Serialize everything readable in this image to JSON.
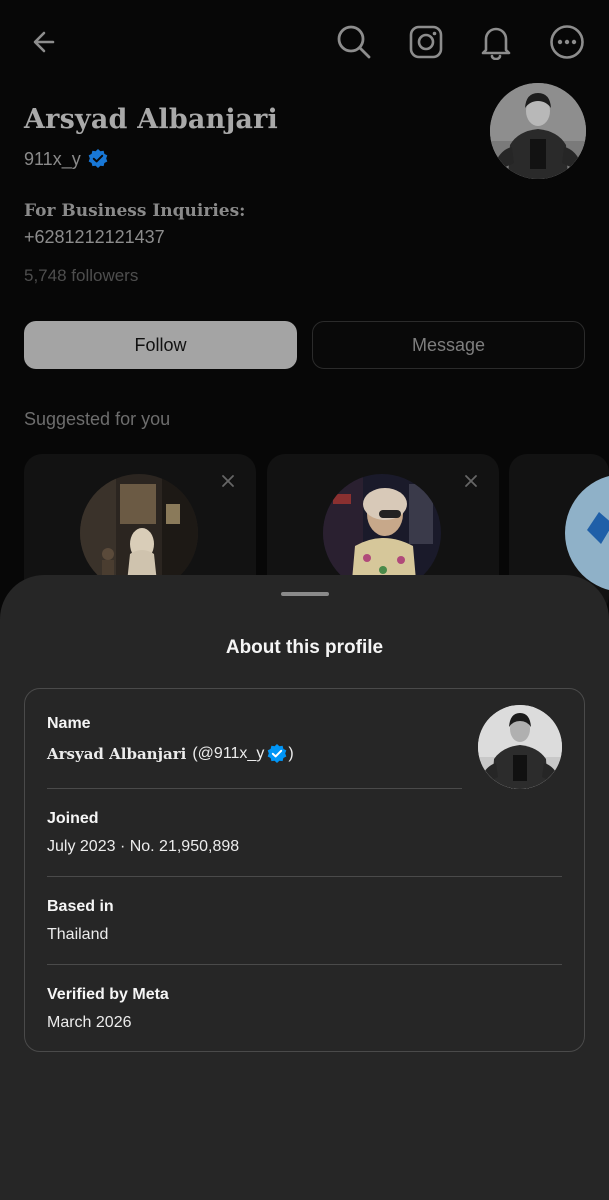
{
  "profile": {
    "name": "Arsyad Albanjari",
    "username": "911x_y",
    "bio_title": "For Business Inquiries:",
    "bio_phone": "+6281212121437",
    "followers": "5,748 followers"
  },
  "actions": {
    "follow_label": "Follow",
    "message_label": "Message"
  },
  "suggested": {
    "title": "Suggested for you"
  },
  "about_sheet": {
    "title": "About this profile",
    "name_label": "Name",
    "name_display": "Arsyad Albanjari",
    "name_handle_open": "(@911x_y",
    "name_handle_close": ")",
    "joined_label": "Joined",
    "joined_value": "July 2023 · No. 21,950,898",
    "based_label": "Based in",
    "based_value": "Thailand",
    "verified_label": "Verified by Meta",
    "verified_value": "March 2026"
  },
  "icons": {
    "back": "back-arrow-icon",
    "search": "search-icon",
    "instagram": "instagram-icon",
    "notifications": "bell-icon",
    "more": "more-icon",
    "verified": "verified-badge-icon",
    "close": "close-icon"
  },
  "colors": {
    "verified_blue": "#0095f6",
    "sheet_background": "#262626",
    "page_background": "#070707"
  }
}
